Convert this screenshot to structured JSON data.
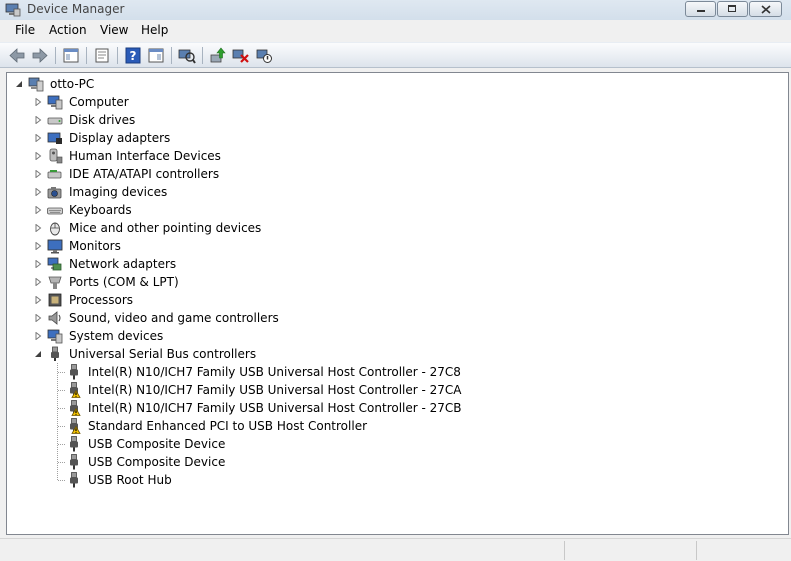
{
  "window": {
    "title": "Device Manager"
  },
  "menu": {
    "items": [
      "File",
      "Action",
      "View",
      "Help"
    ]
  },
  "toolbar": {
    "buttons": [
      "back-arrow-icon",
      "forward-arrow-icon",
      "show-hide-console-tree-icon",
      "properties-icon",
      "help-icon",
      "action-pane-icon",
      "scan-hardware-icon",
      "update-driver-icon",
      "uninstall-icon",
      "disable-device-icon"
    ]
  },
  "tree": {
    "root": {
      "label": "otto-PC",
      "expanded": true
    },
    "categories": [
      {
        "label": "Computer",
        "icon": "computer-icon"
      },
      {
        "label": "Disk drives",
        "icon": "disk-drive-icon"
      },
      {
        "label": "Display adapters",
        "icon": "display-adapter-icon"
      },
      {
        "label": "Human Interface Devices",
        "icon": "hid-icon"
      },
      {
        "label": "IDE ATA/ATAPI controllers",
        "icon": "ide-controller-icon"
      },
      {
        "label": "Imaging devices",
        "icon": "camera-icon"
      },
      {
        "label": "Keyboards",
        "icon": "keyboard-icon"
      },
      {
        "label": "Mice and other pointing devices",
        "icon": "mouse-icon"
      },
      {
        "label": "Monitors",
        "icon": "monitor-icon"
      },
      {
        "label": "Network adapters",
        "icon": "network-adapter-icon"
      },
      {
        "label": "Ports (COM & LPT)",
        "icon": "port-icon"
      },
      {
        "label": "Processors",
        "icon": "processor-icon"
      },
      {
        "label": "Sound, video and game controllers",
        "icon": "speaker-icon"
      },
      {
        "label": "System devices",
        "icon": "system-devices-icon"
      },
      {
        "label": "Universal Serial Bus controllers",
        "icon": "usb-icon",
        "expanded": true
      }
    ],
    "usb_children": [
      {
        "label": "Intel(R) N10/ICH7 Family USB Universal Host Controller - 27C8",
        "warning": false
      },
      {
        "label": "Intel(R) N10/ICH7 Family USB Universal Host Controller - 27CA",
        "warning": true
      },
      {
        "label": "Intel(R) N10/ICH7 Family USB Universal Host Controller - 27CB",
        "warning": true
      },
      {
        "label": "Standard Enhanced PCI to USB Host Controller",
        "warning": true
      },
      {
        "label": "USB Composite Device",
        "warning": false
      },
      {
        "label": "USB Composite Device",
        "warning": false
      },
      {
        "label": "USB Root Hub",
        "warning": false
      }
    ]
  },
  "colors": {
    "selection": "#3399ff",
    "warning": "#f5c400",
    "titlebar": "#dfe8f1"
  }
}
